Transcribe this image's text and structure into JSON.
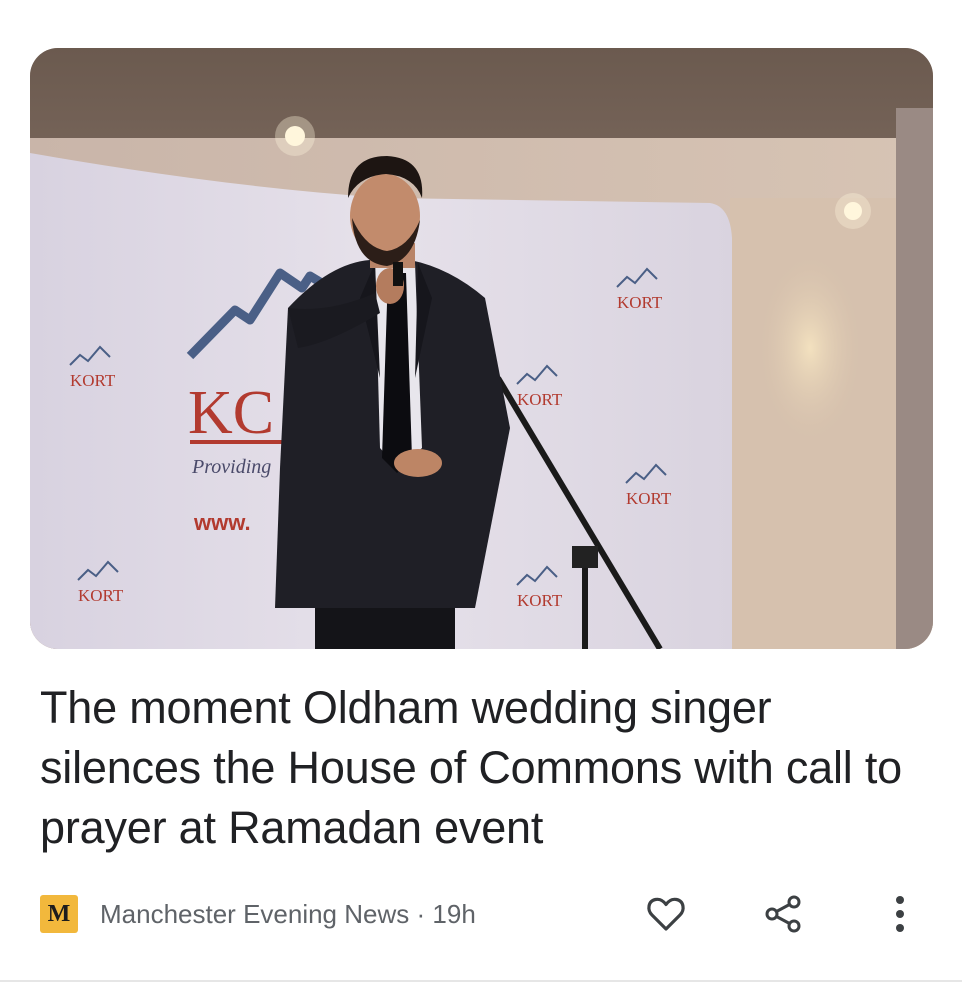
{
  "article": {
    "headline": "The moment Oldham wedding singer silences the House of Commons with call to prayer at Ramadan event",
    "publisher": {
      "name": "Manchester Evening News",
      "logo_letter": "M",
      "logo_color": "#f2b83c"
    },
    "separator": "·",
    "age": "19h"
  },
  "image": {
    "backdrop_brand": "KORT",
    "big_letters": "KC",
    "tagline": "Providing",
    "url_text": "www."
  },
  "actions": {
    "like_icon": "heart-icon",
    "share_icon": "share-icon",
    "more_icon": "more-vertical-icon"
  },
  "colors": {
    "text_primary": "#202124",
    "text_secondary": "#5f6368",
    "brand_red": "#b23a2f"
  }
}
